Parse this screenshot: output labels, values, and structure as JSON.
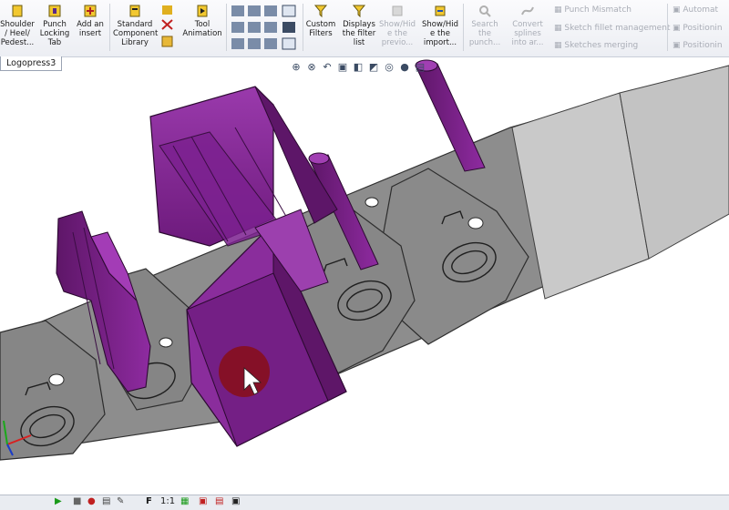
{
  "ribbon": {
    "buttons": [
      {
        "l1": "Shoulder",
        "l2": "/ Heel/",
        "l3": "Pedest..."
      },
      {
        "l1": "Punch",
        "l2": "Locking",
        "l3": "Tab"
      },
      {
        "l1": "Add an",
        "l2": "insert",
        "l3": ""
      },
      {
        "l1": "Standard",
        "l2": "Component",
        "l3": "Library"
      },
      {
        "l1": "Tool",
        "l2": "Animation",
        "l3": ""
      },
      {
        "l1": "Custom",
        "l2": "Filters",
        "l3": ""
      },
      {
        "l1": "Displays",
        "l2": "the filter",
        "l3": "list"
      },
      {
        "l1": "Show/Hid",
        "l2": "e the",
        "l3": "previo..."
      },
      {
        "l1": "Show/Hid",
        "l2": "e the",
        "l3": "import..."
      },
      {
        "l1": "Search",
        "l2": "the",
        "l3": "punch..."
      },
      {
        "l1": "Convert",
        "l2": "splines",
        "l3": "into ar..."
      }
    ],
    "small": [
      {
        "label": "Punch Mismatch"
      },
      {
        "label": "Sketch fillet management"
      },
      {
        "label": "Sketches merging"
      },
      {
        "label": "Automat"
      },
      {
        "label": "Positionin"
      },
      {
        "label": "Positionin"
      }
    ]
  },
  "tab": {
    "label": "Logopress3"
  },
  "statusbar": {
    "f_label": "F",
    "scale_label": "1:1"
  },
  "colors": {
    "purple": "#7a1f86",
    "sheet": "#8a8a8a",
    "ribbon_bg": "#eceef3"
  }
}
